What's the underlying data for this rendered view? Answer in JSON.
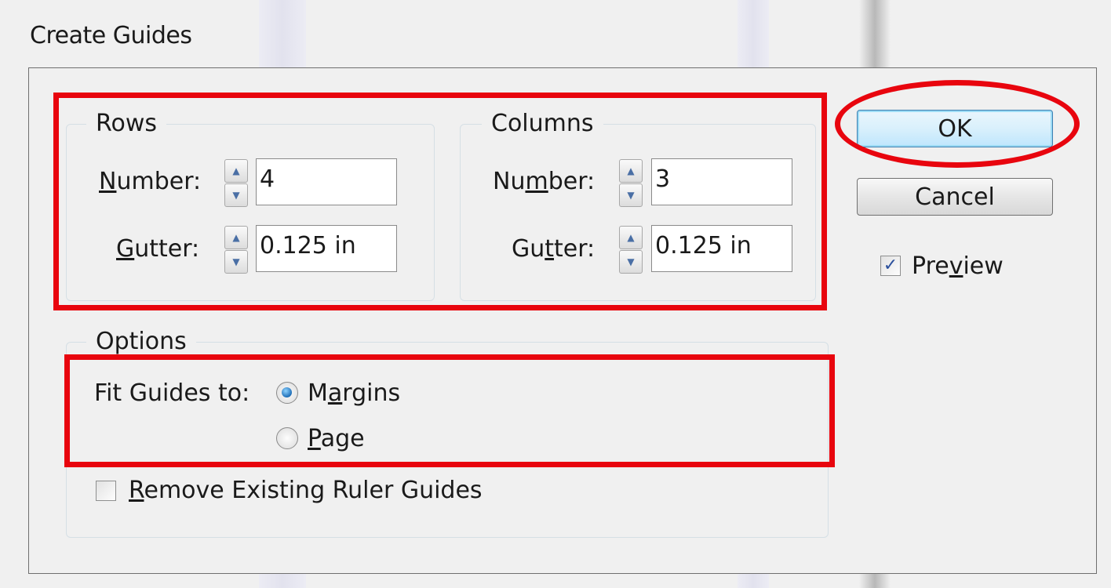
{
  "dialog": {
    "title": "Create Guides",
    "ok_label": "OK",
    "cancel_label": "Cancel",
    "preview": {
      "label_pre": "Pre",
      "label_access": "v",
      "label_post": "iew",
      "checked": true
    }
  },
  "rows": {
    "legend": "Rows",
    "number_label_access": "N",
    "number_label_rest": "umber:",
    "number_value": "4",
    "gutter_label_access": "G",
    "gutter_label_rest": "utter:",
    "gutter_value": "0.125 in"
  },
  "columns": {
    "legend": "Columns",
    "number_label_pre": "Nu",
    "number_label_access": "m",
    "number_label_post": "ber:",
    "number_value": "3",
    "gutter_label_pre": "Gu",
    "gutter_label_access": "t",
    "gutter_label_post": "ter:",
    "gutter_value": "0.125 in"
  },
  "options": {
    "legend": "Options",
    "fit_label": "Fit Guides to:",
    "margins": {
      "label_pre": "M",
      "label_access": "a",
      "label_post": "rgins",
      "selected": true
    },
    "page": {
      "label_access": "P",
      "label_post": "age",
      "selected": false
    },
    "remove_existing": {
      "label_access": "R",
      "label_post": "emove Existing Ruler Guides",
      "checked": false
    }
  },
  "icons": {
    "spin_up": "▲",
    "spin_down": "▼",
    "check": "✓"
  },
  "annotation_color": "#e8050e"
}
